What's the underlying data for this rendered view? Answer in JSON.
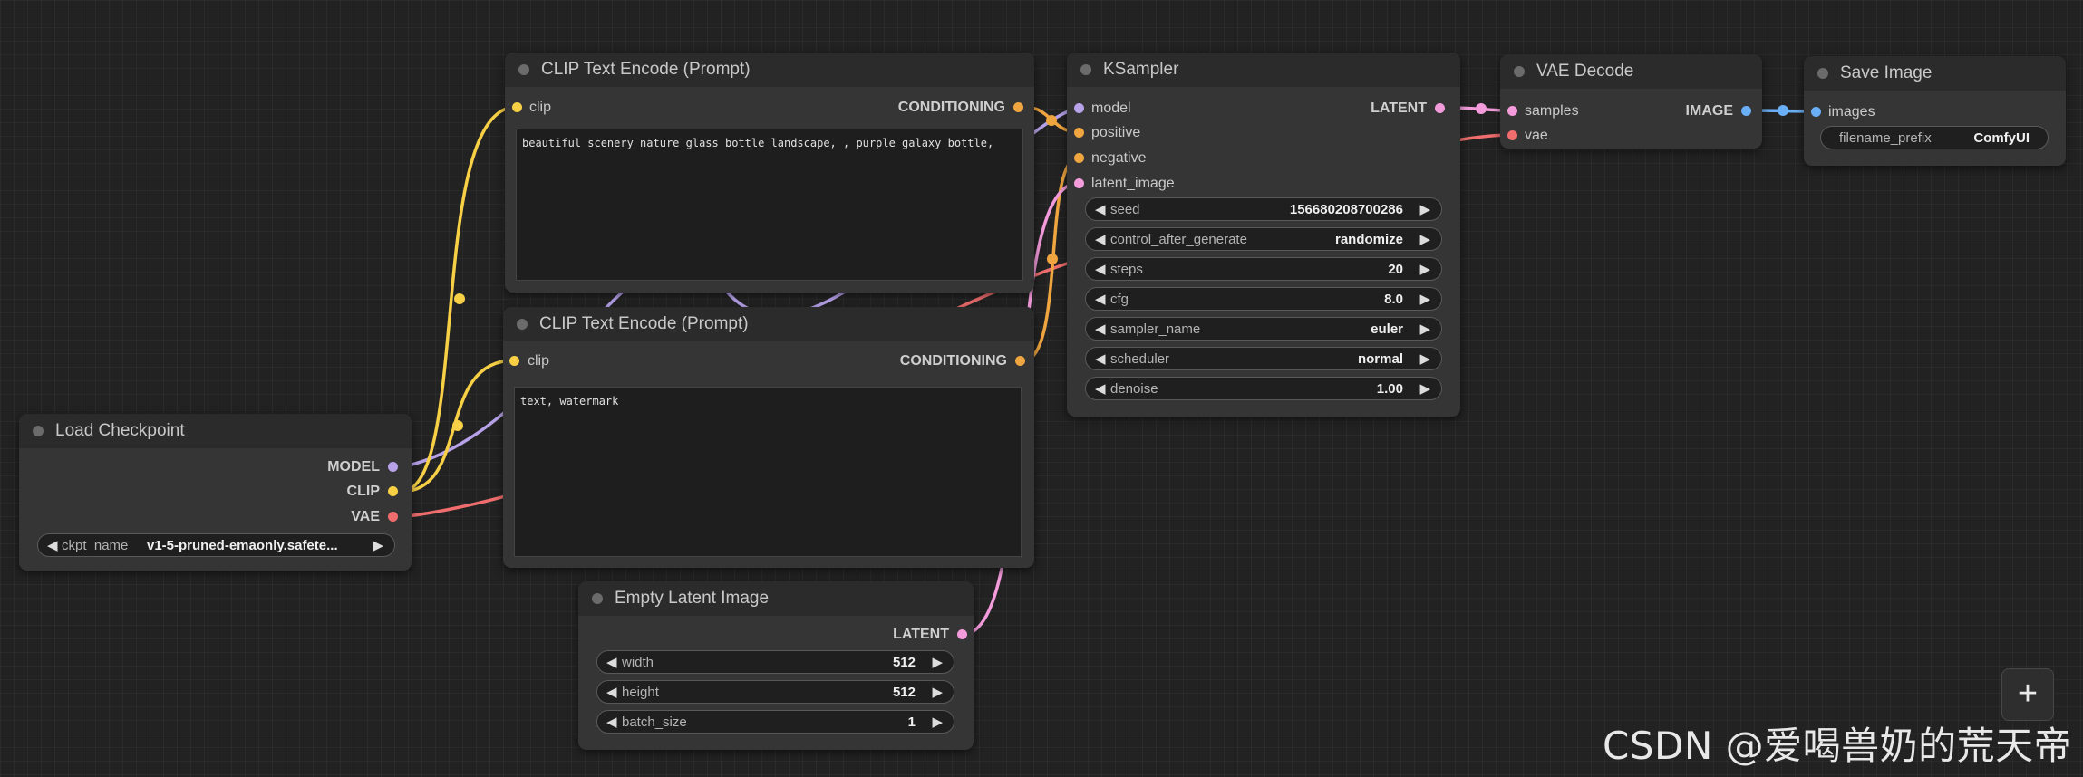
{
  "colors": {
    "clip": "#f7d046",
    "conditioning": "#f0a640",
    "model": "#b7a2ea",
    "vae": "#ef6d6d",
    "latent": "#f49bdc",
    "image": "#6aaef5"
  },
  "nodes": {
    "load_checkpoint": {
      "title": "Load Checkpoint",
      "outputs": [
        "MODEL",
        "CLIP",
        "VAE"
      ],
      "widget": {
        "name": "ckpt_name",
        "value": "v1-5-pruned-emaonly.safete..."
      }
    },
    "clip_pos": {
      "title": "CLIP Text Encode (Prompt)",
      "input": "clip",
      "output": "CONDITIONING",
      "text": "beautiful scenery nature glass bottle landscape, , purple galaxy bottle,"
    },
    "clip_neg": {
      "title": "CLIP Text Encode (Prompt)",
      "input": "clip",
      "output": "CONDITIONING",
      "text": "text, watermark"
    },
    "empty_latent": {
      "title": "Empty Latent Image",
      "output": "LATENT",
      "widgets": [
        {
          "name": "width",
          "value": "512"
        },
        {
          "name": "height",
          "value": "512"
        },
        {
          "name": "batch_size",
          "value": "1"
        }
      ]
    },
    "ksampler": {
      "title": "KSampler",
      "inputs": [
        "model",
        "positive",
        "negative",
        "latent_image"
      ],
      "output": "LATENT",
      "widgets": [
        {
          "name": "seed",
          "value": "156680208700286"
        },
        {
          "name": "control_after_generate",
          "value": "randomize"
        },
        {
          "name": "steps",
          "value": "20"
        },
        {
          "name": "cfg",
          "value": "8.0"
        },
        {
          "name": "sampler_name",
          "value": "euler"
        },
        {
          "name": "scheduler",
          "value": "normal"
        },
        {
          "name": "denoise",
          "value": "1.00"
        }
      ]
    },
    "vae_decode": {
      "title": "VAE Decode",
      "inputs": [
        "samples",
        "vae"
      ],
      "output": "IMAGE"
    },
    "save_image": {
      "title": "Save Image",
      "input": "images",
      "widget": {
        "name": "filename_prefix",
        "value": "ComfyUI"
      }
    }
  },
  "controls": {
    "add_button": "+"
  },
  "watermark": "CSDN @爱喝兽奶的荒天帝"
}
